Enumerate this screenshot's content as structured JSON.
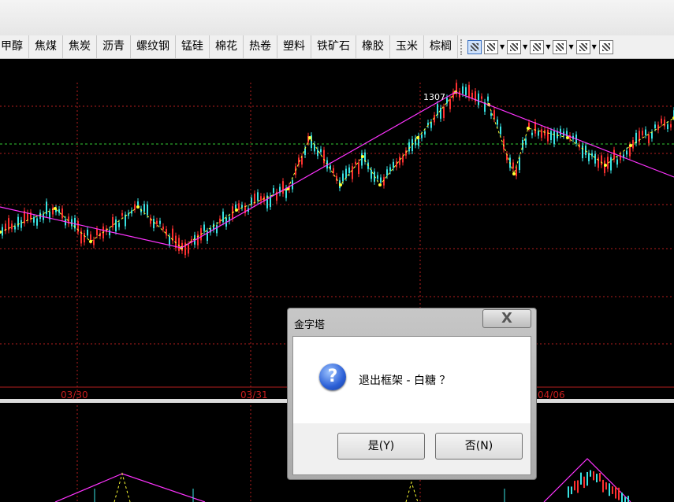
{
  "toolbar": {
    "tabs": [
      "甲醇",
      "焦煤",
      "焦炭",
      "沥青",
      "螺纹钢",
      "锰硅",
      "棉花",
      "热卷",
      "塑料",
      "铁矿石",
      "橡胶",
      "玉米",
      "棕榈"
    ],
    "tools": [
      "draw-tool-icon",
      "line-tool-icon",
      "indicator-tool-icon",
      "bars-tool-icon",
      "axis-tool-icon",
      "grid-tool-icon",
      "hatch-tool-icon"
    ]
  },
  "chart": {
    "peak_label": "1307",
    "date_labels": [
      "03/30",
      "03/31",
      "04/06"
    ],
    "colors": {
      "background": "#000000",
      "grid": "#b41e1e",
      "up_candle": "#ff3030",
      "down_candle": "#38e3e3",
      "trend_line": "#ff33ff",
      "zigzag": "#ffff33",
      "reference_line": "#33cc33"
    }
  },
  "dialog": {
    "title": "金字塔",
    "close_symbol": "X",
    "icon_symbol": "?",
    "message": "退出框架 - 白糖 ？",
    "yes_label": "是(Y)",
    "no_label": "否(N)"
  }
}
